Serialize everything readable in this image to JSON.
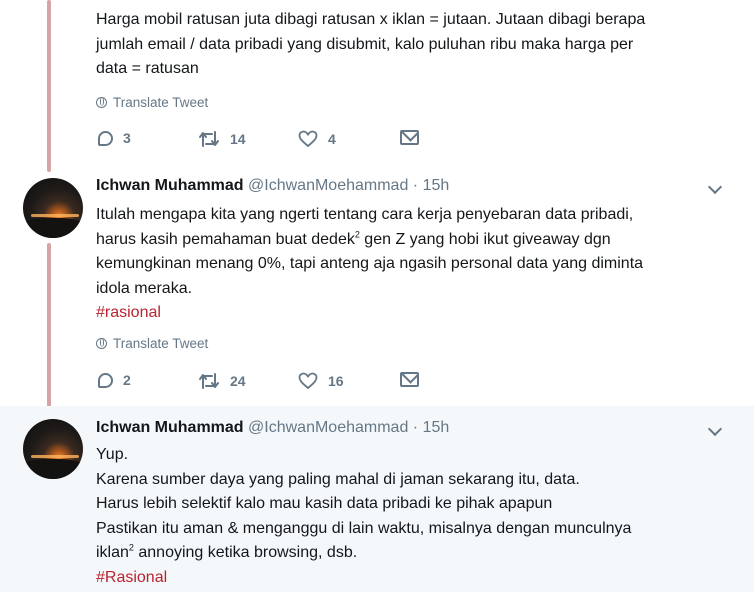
{
  "tweets": [
    {
      "lines": [
        "Harga mobil ratusan juta dibagi ratusan x iklan = jutaan. Jutaan dibagi berapa",
        "jumlah email / data pribadi yang disubmit, kalo puluhan ribu maka harga per",
        "data = ratusan"
      ],
      "translate_label": "Translate Tweet",
      "reply_count": "3",
      "retweet_count": "14",
      "like_count": "4"
    },
    {
      "name": "Ichwan Muhammad",
      "handle": "@IchwanMoehammad",
      "dot": "·",
      "time": "15h",
      "line1": "Itulah mengapa kita yang ngerti tentang cara kerja penyebaran data pribadi,",
      "line2_a": "harus kasih pemahaman buat dedek",
      "line2_sup": "2",
      "line2_b": " gen Z yang hobi ikut giveaway dgn",
      "line3": "kemungkinan menang 0%, tapi anteng aja ngasih personal data yang diminta",
      "line4": "idola meraka.",
      "hashtag": "#rasional",
      "translate_label": "Translate Tweet",
      "reply_count": "2",
      "retweet_count": "24",
      "like_count": "16"
    },
    {
      "name": "Ichwan Muhammad",
      "handle": "@IchwanMoehammad",
      "dot": "·",
      "time": "15h",
      "line1": "Yup.",
      "line2": "Karena sumber daya yang paling mahal di jaman sekarang itu, data.",
      "line3": "Harus lebih selektif kalo mau kasih data pribadi ke pihak apapun",
      "line4": "Pastikan itu aman & menganggu di lain waktu, misalnya dengan munculnya",
      "line5_a": "iklan",
      "line5_sup": "2",
      "line5_b": " annoying ketika browsing, dsb.",
      "hashtag": "#Rasional"
    }
  ],
  "colors": {
    "thread_line": "#d6a3a7",
    "hashtag": "#b8242f",
    "muted": "#657786",
    "highlight_bg": "#f5f8fa"
  },
  "icons": [
    "globe-icon",
    "reply-icon",
    "retweet-icon",
    "like-icon",
    "direct-message-icon",
    "chevron-down-icon"
  ]
}
